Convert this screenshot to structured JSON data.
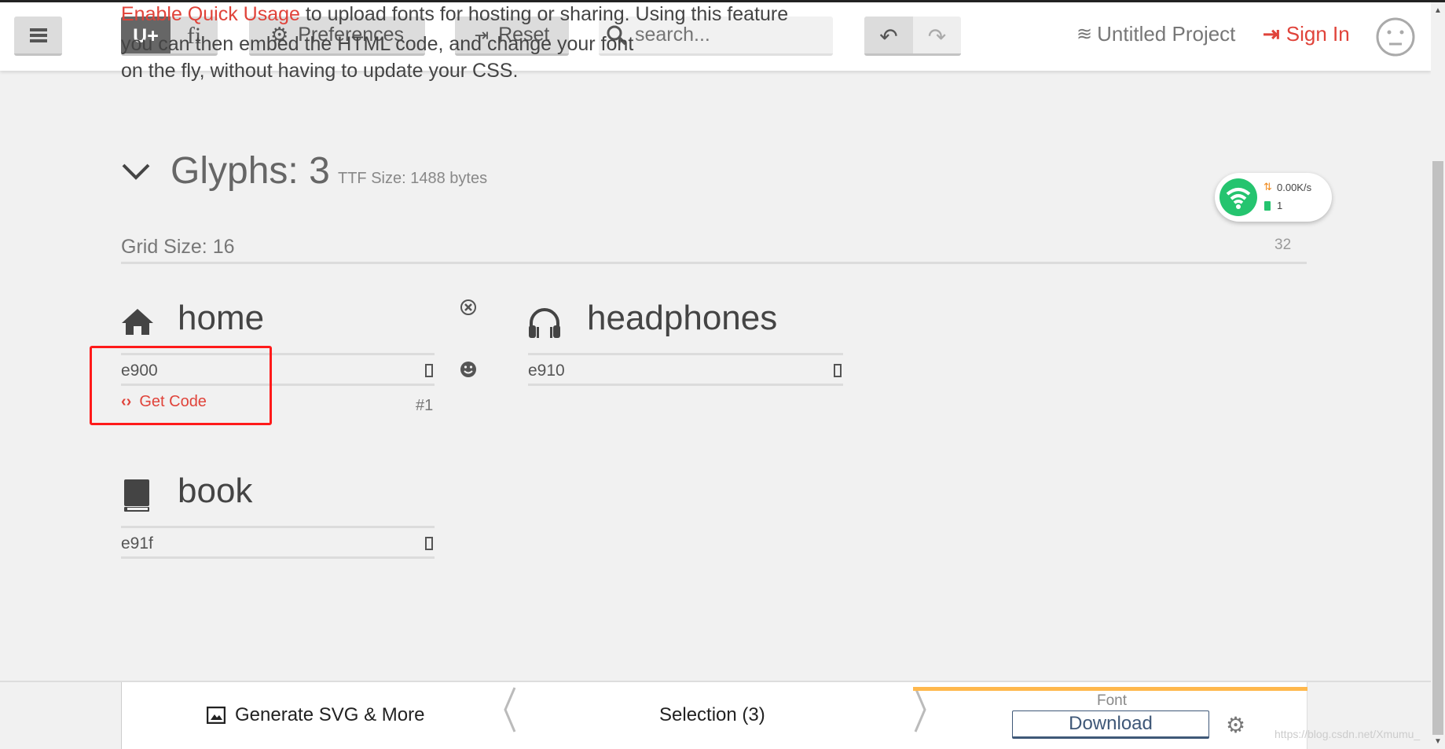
{
  "background_text": {
    "line1_link": "Enable Quick Usage",
    "line1_rest": " to upload fonts for hosting or sharing. Using this feature",
    "line2": "you can then embed the HTML code, and change your font",
    "line3": "on the fly, without having to update your CSS."
  },
  "toolbar": {
    "unicode_label": "U+",
    "ligature_label": "fi",
    "preferences_label": "Preferences",
    "reset_label": "Reset",
    "search_placeholder": "search...",
    "project_name": "Untitled Project",
    "sign_in_label": "Sign In"
  },
  "glyphs": {
    "title": "Glyphs: 3",
    "ttf_size": "TTF Size: 1488 bytes",
    "grid_size": "Grid Size: 16",
    "grid_max": "32",
    "items": [
      {
        "name": "home",
        "code": "e900",
        "get_code": "Get Code",
        "index": "#1",
        "icon": "home-icon"
      },
      {
        "name": "headphones",
        "code": "e910",
        "icon": "headphones-icon"
      },
      {
        "name": "book",
        "code": "e91f",
        "icon": "book-icon"
      }
    ]
  },
  "network_widget": {
    "speed": "0.00K/s",
    "devices": "1",
    "color": "#25c46f"
  },
  "bottom_bar": {
    "generate_label": "Generate SVG & More",
    "selection_label": "Selection (3)",
    "font_label": "Font",
    "download_label": "Download",
    "watermark": "https://blog.csdn.net/Xmumu_"
  },
  "colors": {
    "accent": "#e0433a",
    "highlight_box": "#ff1a1a",
    "font_tab": "#ffb84d"
  }
}
